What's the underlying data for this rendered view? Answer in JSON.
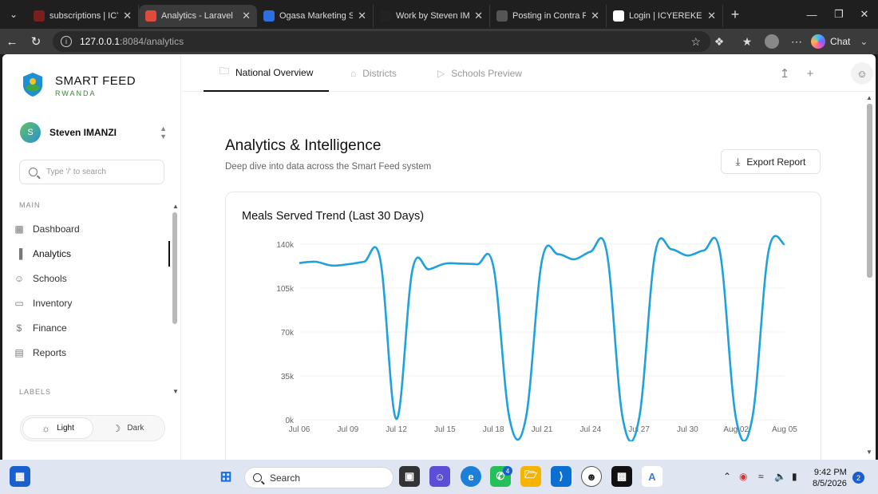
{
  "browser": {
    "tabs": [
      {
        "title": "subscriptions | ICYEREKEZO",
        "fav_color": "#7a1f1f"
      },
      {
        "title": "Analytics - Laravel",
        "fav_color": "#e04a3a"
      },
      {
        "title": "Ogasa Marketing Strategy",
        "fav_color": "#2d6fe0"
      },
      {
        "title": "Work by Steven IMANZI",
        "fav_color": "#222222"
      },
      {
        "title": "Posting in Contra Portfolio",
        "fav_color": "#555555"
      },
      {
        "title": "Login | ICYEREKEZO Capital",
        "fav_color": "#ffffff"
      }
    ],
    "url_host": "127.0.0.1",
    "url_path": ":8084/analytics",
    "chat_label": "Chat"
  },
  "sidebar": {
    "brand_name": "SMART FEED",
    "brand_sub": "RWANDA",
    "user_initial": "S",
    "user_name": "Steven IMANZI",
    "search_placeholder": "Type '/' to search",
    "section_main": "MAIN",
    "items": [
      {
        "label": "Dashboard",
        "icon": "grid-icon"
      },
      {
        "label": "Analytics",
        "icon": "bar-chart-icon"
      },
      {
        "label": "Schools",
        "icon": "users-icon"
      },
      {
        "label": "Inventory",
        "icon": "folder-icon"
      },
      {
        "label": "Finance",
        "icon": "dollar-icon"
      },
      {
        "label": "Reports",
        "icon": "file-icon"
      }
    ],
    "section_labels": "LABELS",
    "theme_light": "Light",
    "theme_dark": "Dark"
  },
  "topnav": {
    "tabs": [
      {
        "label": "National Overview"
      },
      {
        "label": "Districts"
      },
      {
        "label": "Schools Preview"
      }
    ]
  },
  "main": {
    "title": "Analytics & Intelligence",
    "subtitle": "Deep dive into data across the Smart Feed system",
    "export_label": "Export Report",
    "chart_title": "Meals Served Trend (Last 30 Days)"
  },
  "chart_data": {
    "type": "line",
    "title": "Meals Served Trend (Last 30 Days)",
    "xlabel": "",
    "ylabel": "",
    "ylim": [
      0,
      140000
    ],
    "y_ticks": [
      "0k",
      "35k",
      "70k",
      "105k",
      "140k"
    ],
    "y_tick_values": [
      0,
      35000,
      70000,
      105000,
      140000
    ],
    "x_tick_labels": [
      "Jul 06",
      "Jul 09",
      "Jul 12",
      "Jul 15",
      "Jul 18",
      "Jul 21",
      "Jul 24",
      "Jul 27",
      "Jul 30",
      "Aug 02",
      "Aug 05"
    ],
    "x_tick_index": [
      0,
      3,
      6,
      9,
      12,
      15,
      18,
      21,
      24,
      27,
      30
    ],
    "color": "#1ea1dc",
    "grid": true,
    "series": [
      {
        "values": [
          125000,
          126000,
          123000,
          124000,
          126000,
          128000,
          600,
          120000,
          120000,
          124500,
          124500,
          124000,
          122000,
          600,
          1000,
          127000,
          132000,
          128000,
          134000,
          134000,
          600,
          800,
          133000,
          136000,
          131000,
          135000,
          134000,
          700,
          1200,
          134000,
          140000
        ]
      }
    ]
  },
  "taskbar": {
    "search_label": "Search",
    "whatsapp_badge": "4",
    "time": "9:42 PM",
    "date": "8/5/2026",
    "notifications": "2"
  }
}
